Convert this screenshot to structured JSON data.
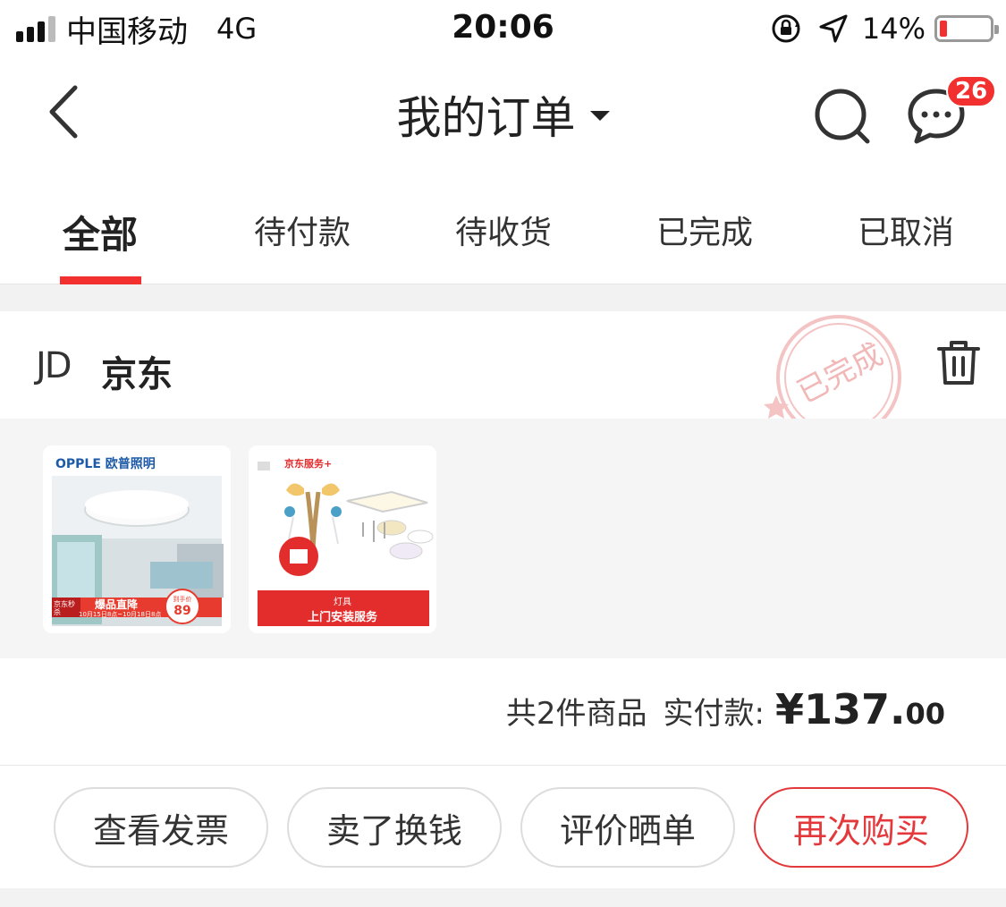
{
  "status_bar": {
    "carrier": "中国移动",
    "network": "4G",
    "time": "20:06",
    "battery_percent": "14%",
    "battery_level": 0.14,
    "icons": [
      "signal-bars-icon",
      "orientation-lock-icon",
      "location-arrow-icon",
      "battery-icon"
    ]
  },
  "nav": {
    "title": "我的订单",
    "message_badge": "26",
    "icons": [
      "back-arrow-icon",
      "dropdown-caret-icon",
      "search-icon",
      "message-bubble-icon"
    ]
  },
  "tabs": [
    {
      "label": "全部",
      "active": true
    },
    {
      "label": "待付款",
      "active": false
    },
    {
      "label": "待收货",
      "active": false
    },
    {
      "label": "已完成",
      "active": false
    },
    {
      "label": "已取消",
      "active": false
    }
  ],
  "order": {
    "shop_logo": "JD",
    "shop_name": "京东",
    "status_stamp": "已完成",
    "products": [
      {
        "brand": "OPPLE 欧普照明",
        "banner_left": "京东秒杀",
        "banner_main": "爆品直降",
        "banner_dates": "10月15日8点~10月18日8点",
        "price_tag_label": "到手价",
        "price_tag_value": "89"
      },
      {
        "brand": "京东服务+",
        "banner_top": "灯具",
        "banner_main": "上门安装服务"
      }
    ],
    "item_count_text": "共2件商品",
    "paid_label": "实付款:",
    "price_integer": "¥137.",
    "price_decimal": "00"
  },
  "actions": [
    {
      "label": "查看发票",
      "primary": false
    },
    {
      "label": "卖了换钱",
      "primary": false
    },
    {
      "label": "评价晒单",
      "primary": false
    },
    {
      "label": "再次购买",
      "primary": true
    }
  ],
  "colors": {
    "accent_red": "#f23030",
    "button_red": "#e4393c",
    "background": "#f2f2f2"
  }
}
